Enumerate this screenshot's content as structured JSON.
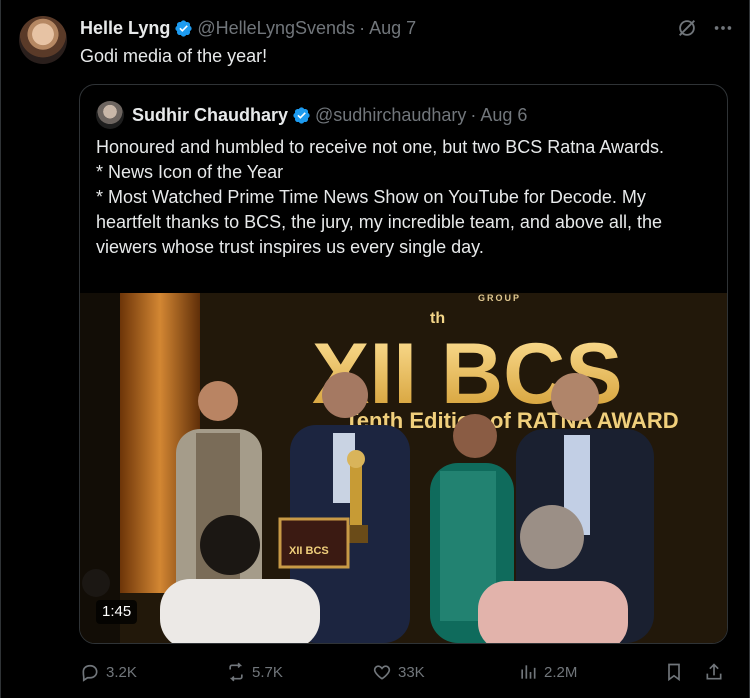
{
  "tweet": {
    "author_name": "Helle Lyng",
    "author_handle": "@HelleLyngSvends",
    "separator": "·",
    "date": "Aug 7",
    "text": "Godi media of the year!"
  },
  "quote": {
    "author_name": "Sudhir Chaudhary",
    "author_handle": "@sudhirchaudhary",
    "separator": "·",
    "date": "Aug 6",
    "text": "Honoured and humbled to receive not one, but two BCS Ratna Awards.\n* News Icon of the Year\n* Most Watched Prime Time News Show on YouTube for Decode. My heartfelt thanks to BCS, the jury, my incredible team, and above all, the viewers whose trust inspires us every single day.",
    "video": {
      "duration": "1:45",
      "backdrop_text": {
        "group": "GROUP",
        "superscript": "th",
        "big": "XII BCS",
        "sub": "Tenth Edition of RATNA AWARD",
        "plaque": "XII BCS"
      }
    }
  },
  "actions": {
    "replies": "3.2K",
    "reposts": "5.7K",
    "likes": "33K",
    "views": "2.2M"
  },
  "colors": {
    "background": "#000000",
    "text": "#e7e9ea",
    "muted": "#71767b",
    "verified": "#1d9bf0",
    "border": "#2f3336"
  },
  "icons": [
    "verified-badge-icon",
    "grok-icon",
    "more-icon",
    "reply-icon",
    "repost-icon",
    "like-icon",
    "views-icon",
    "bookmark-icon",
    "share-icon"
  ]
}
